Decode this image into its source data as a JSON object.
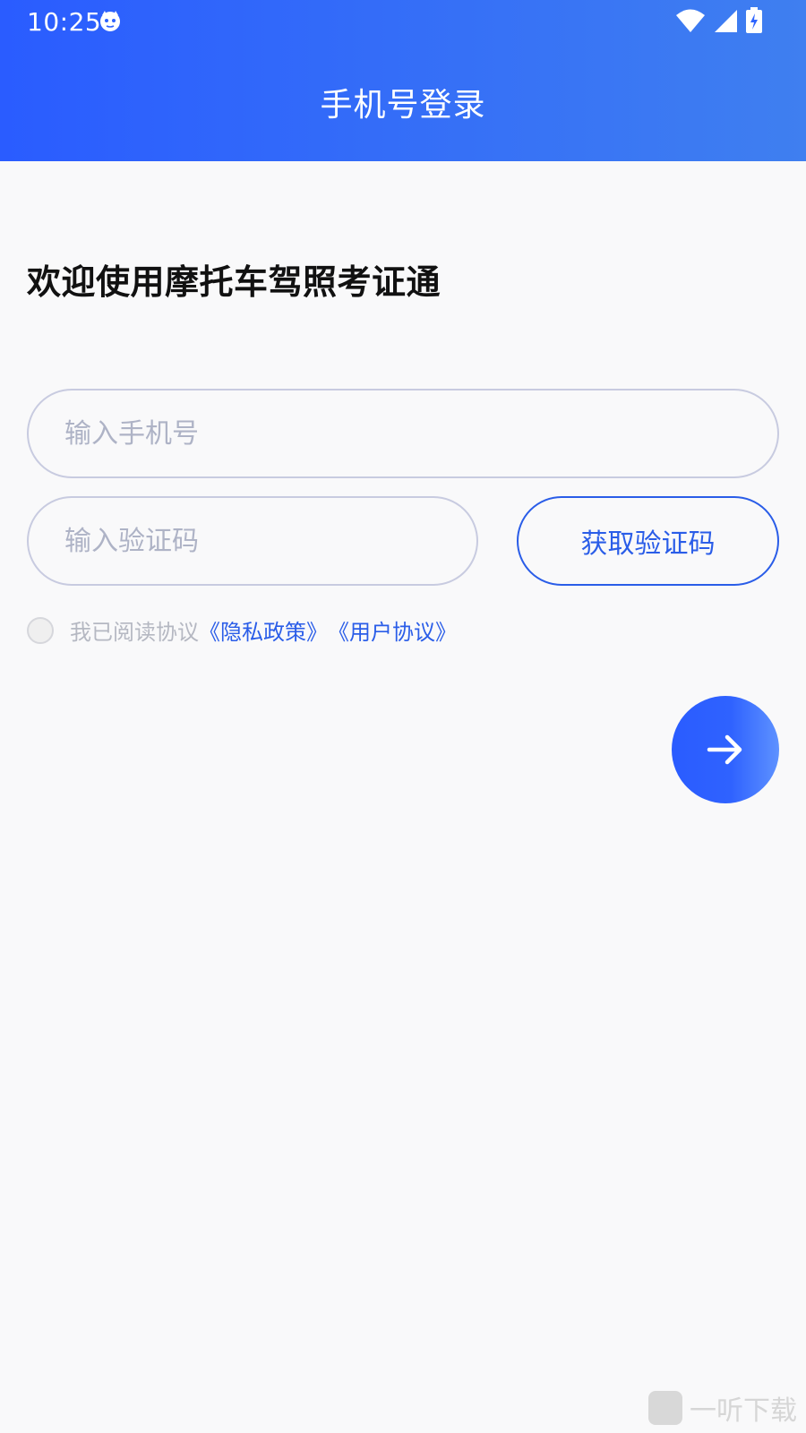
{
  "status_bar": {
    "time": "10:25"
  },
  "header": {
    "title": "手机号登录"
  },
  "welcome": "欢迎使用摩托车驾照考证通",
  "form": {
    "phone_placeholder": "输入手机号",
    "code_placeholder": "输入验证码",
    "get_code_label": "获取验证码"
  },
  "agreement": {
    "prefix": "我已阅读协议",
    "privacy_link": "《隐私政策》",
    "terms_link": "《用户协议》"
  },
  "watermark": {
    "text": "一听下载"
  },
  "colors": {
    "primary": "#2a5de8",
    "header_gradient_start": "#2a5cff",
    "header_gradient_end": "#3f7ff0",
    "placeholder": "#aeb3c6"
  },
  "icons": {
    "status_app": "cat-face-icon",
    "wifi": "wifi-icon",
    "signal": "cell-signal-icon",
    "battery": "battery-charging-icon",
    "next": "arrow-right-icon"
  }
}
